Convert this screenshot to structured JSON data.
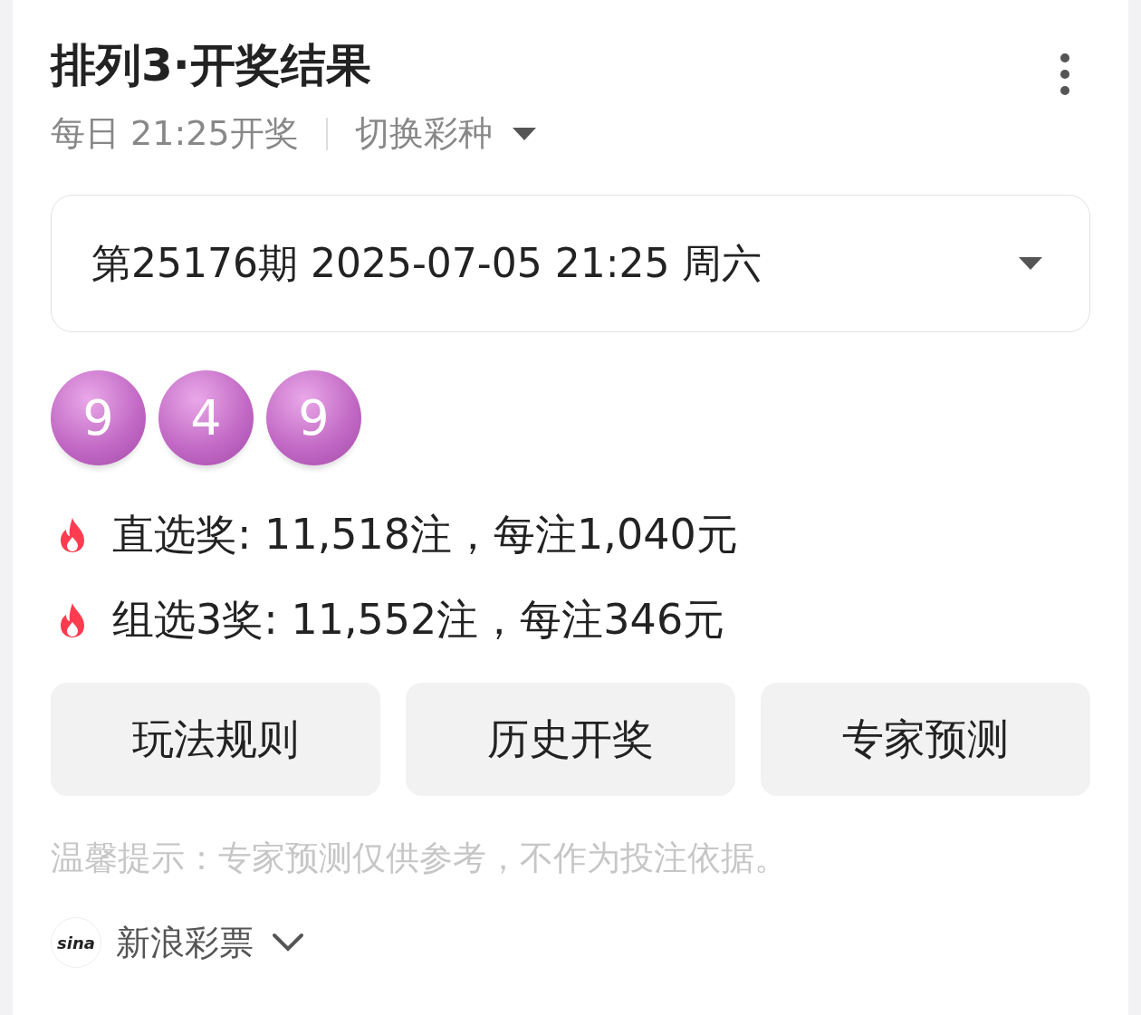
{
  "title": "排列3·开奖结果",
  "schedule": "每日 21:25开奖",
  "switch_label": "切换彩种",
  "draw_select": "第25176期 2025-07-05 21:25 周六",
  "balls": [
    "9",
    "4",
    "9"
  ],
  "prizes": [
    "直选奖: 11,518注，每注1,040元",
    "组选3奖: 11,552注，每注346元"
  ],
  "buttons": [
    "玩法规则",
    "历史开奖",
    "专家预测"
  ],
  "tip": "温馨提示：专家预测仅供参考，不作为投注依据。",
  "source": {
    "logo": "sina",
    "name": "新浪彩票"
  }
}
